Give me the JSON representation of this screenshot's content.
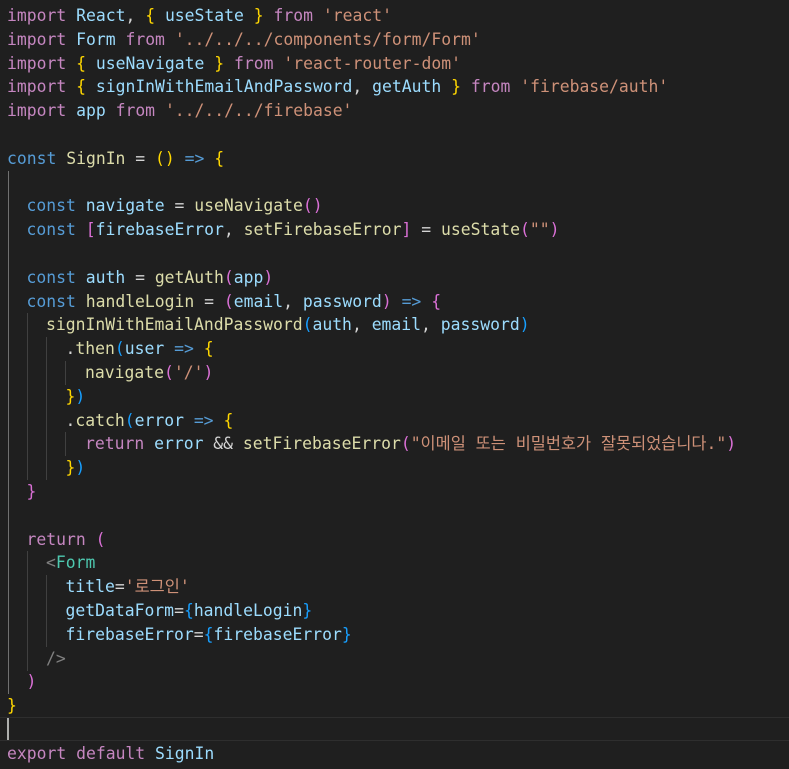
{
  "editor": {
    "colors": {
      "background": "#1f1f1f",
      "keyword_import": "#c586c0",
      "keyword": "#569cd6",
      "identifier": "#9cdcfe",
      "function": "#dcdcaa",
      "string": "#ce9178",
      "operator": "#d4d4d4",
      "bracket_gold": "#ffd700",
      "bracket_purple": "#da70d6",
      "bracket_blue": "#179fff",
      "tag": "#569cd6",
      "component": "#4ec9b0",
      "jsx_tag_bracket": "#808080"
    },
    "cursor_line": 30,
    "lines": [
      {
        "indent": 0,
        "tokens": [
          {
            "t": "import",
            "c": "keyword_import"
          },
          {
            "t": " "
          },
          {
            "t": "React",
            "c": "identifier"
          },
          {
            "t": ", "
          },
          {
            "t": "{",
            "c": "bracket_gold"
          },
          {
            "t": " "
          },
          {
            "t": "useState",
            "c": "identifier"
          },
          {
            "t": " "
          },
          {
            "t": "}",
            "c": "bracket_gold"
          },
          {
            "t": " "
          },
          {
            "t": "from",
            "c": "keyword_import"
          },
          {
            "t": " "
          },
          {
            "t": "'react'",
            "c": "string"
          }
        ]
      },
      {
        "indent": 0,
        "tokens": [
          {
            "t": "import",
            "c": "keyword_import"
          },
          {
            "t": " "
          },
          {
            "t": "Form",
            "c": "identifier"
          },
          {
            "t": " "
          },
          {
            "t": "from",
            "c": "keyword_import"
          },
          {
            "t": " "
          },
          {
            "t": "'../../../components/form/Form'",
            "c": "string"
          }
        ]
      },
      {
        "indent": 0,
        "tokens": [
          {
            "t": "import",
            "c": "keyword_import"
          },
          {
            "t": " "
          },
          {
            "t": "{",
            "c": "bracket_gold"
          },
          {
            "t": " "
          },
          {
            "t": "useNavigate",
            "c": "identifier"
          },
          {
            "t": " "
          },
          {
            "t": "}",
            "c": "bracket_gold"
          },
          {
            "t": " "
          },
          {
            "t": "from",
            "c": "keyword_import"
          },
          {
            "t": " "
          },
          {
            "t": "'react-router-dom'",
            "c": "string"
          }
        ]
      },
      {
        "indent": 0,
        "tokens": [
          {
            "t": "import",
            "c": "keyword_import"
          },
          {
            "t": " "
          },
          {
            "t": "{",
            "c": "bracket_gold"
          },
          {
            "t": " "
          },
          {
            "t": "signInWithEmailAndPassword",
            "c": "identifier"
          },
          {
            "t": ", "
          },
          {
            "t": "getAuth",
            "c": "identifier"
          },
          {
            "t": " "
          },
          {
            "t": "}",
            "c": "bracket_gold"
          },
          {
            "t": " "
          },
          {
            "t": "from",
            "c": "keyword_import"
          },
          {
            "t": " "
          },
          {
            "t": "'firebase/auth'",
            "c": "string"
          }
        ]
      },
      {
        "indent": 0,
        "tokens": [
          {
            "t": "import",
            "c": "keyword_import"
          },
          {
            "t": " "
          },
          {
            "t": "app",
            "c": "identifier"
          },
          {
            "t": " "
          },
          {
            "t": "from",
            "c": "keyword_import"
          },
          {
            "t": " "
          },
          {
            "t": "'../../../firebase'",
            "c": "string"
          }
        ]
      },
      {
        "indent": 0,
        "tokens": []
      },
      {
        "indent": 0,
        "tokens": [
          {
            "t": "const",
            "c": "keyword"
          },
          {
            "t": " "
          },
          {
            "t": "SignIn",
            "c": "function"
          },
          {
            "t": " = "
          },
          {
            "t": "(",
            "c": "bracket_gold"
          },
          {
            "t": ")",
            "c": "bracket_gold"
          },
          {
            "t": " "
          },
          {
            "t": "=>",
            "c": "keyword"
          },
          {
            "t": " "
          },
          {
            "t": "{",
            "c": "bracket_gold"
          }
        ]
      },
      {
        "indent": 0,
        "tokens": [],
        "guides": [
          1
        ]
      },
      {
        "indent": 1,
        "tokens": [
          {
            "t": "const",
            "c": "keyword"
          },
          {
            "t": " "
          },
          {
            "t": "navigate",
            "c": "identifier"
          },
          {
            "t": " = "
          },
          {
            "t": "useNavigate",
            "c": "function"
          },
          {
            "t": "(",
            "c": "bracket_purple"
          },
          {
            "t": ")",
            "c": "bracket_purple"
          }
        ],
        "guides": [
          1
        ]
      },
      {
        "indent": 1,
        "tokens": [
          {
            "t": "const",
            "c": "keyword"
          },
          {
            "t": " "
          },
          {
            "t": "[",
            "c": "bracket_purple"
          },
          {
            "t": "firebaseError",
            "c": "identifier"
          },
          {
            "t": ", "
          },
          {
            "t": "setFirebaseError",
            "c": "function"
          },
          {
            "t": "]",
            "c": "bracket_purple"
          },
          {
            "t": " = "
          },
          {
            "t": "useState",
            "c": "function"
          },
          {
            "t": "(",
            "c": "bracket_purple"
          },
          {
            "t": "\"\"",
            "c": "string"
          },
          {
            "t": ")",
            "c": "bracket_purple"
          }
        ],
        "guides": [
          1
        ]
      },
      {
        "indent": 0,
        "tokens": [],
        "guides": [
          1
        ]
      },
      {
        "indent": 1,
        "tokens": [
          {
            "t": "const",
            "c": "keyword"
          },
          {
            "t": " "
          },
          {
            "t": "auth",
            "c": "identifier"
          },
          {
            "t": " = "
          },
          {
            "t": "getAuth",
            "c": "function"
          },
          {
            "t": "(",
            "c": "bracket_purple"
          },
          {
            "t": "app",
            "c": "identifier"
          },
          {
            "t": ")",
            "c": "bracket_purple"
          }
        ],
        "guides": [
          1
        ]
      },
      {
        "indent": 1,
        "tokens": [
          {
            "t": "const",
            "c": "keyword"
          },
          {
            "t": " "
          },
          {
            "t": "handleLogin",
            "c": "function"
          },
          {
            "t": " = "
          },
          {
            "t": "(",
            "c": "bracket_purple"
          },
          {
            "t": "email",
            "c": "identifier"
          },
          {
            "t": ", "
          },
          {
            "t": "password",
            "c": "identifier"
          },
          {
            "t": ")",
            "c": "bracket_purple"
          },
          {
            "t": " "
          },
          {
            "t": "=>",
            "c": "keyword"
          },
          {
            "t": " "
          },
          {
            "t": "{",
            "c": "bracket_purple"
          }
        ],
        "guides": [
          1
        ]
      },
      {
        "indent": 2,
        "tokens": [
          {
            "t": "signInWithEmailAndPassword",
            "c": "function"
          },
          {
            "t": "(",
            "c": "bracket_blue"
          },
          {
            "t": "auth",
            "c": "identifier"
          },
          {
            "t": ", "
          },
          {
            "t": "email",
            "c": "identifier"
          },
          {
            "t": ", "
          },
          {
            "t": "password",
            "c": "identifier"
          },
          {
            "t": ")",
            "c": "bracket_blue"
          }
        ],
        "guides": [
          1,
          2
        ]
      },
      {
        "indent": 3,
        "tokens": [
          {
            "t": ".",
            "c": "operator"
          },
          {
            "t": "then",
            "c": "function"
          },
          {
            "t": "(",
            "c": "bracket_blue"
          },
          {
            "t": "user",
            "c": "identifier"
          },
          {
            "t": " "
          },
          {
            "t": "=>",
            "c": "keyword"
          },
          {
            "t": " "
          },
          {
            "t": "{",
            "c": "bracket_gold"
          }
        ],
        "guides": [
          1,
          2,
          3
        ]
      },
      {
        "indent": 4,
        "tokens": [
          {
            "t": "navigate",
            "c": "function"
          },
          {
            "t": "(",
            "c": "bracket_purple"
          },
          {
            "t": "'/'",
            "c": "string"
          },
          {
            "t": ")",
            "c": "bracket_purple"
          }
        ],
        "guides": [
          1,
          2,
          3,
          4
        ]
      },
      {
        "indent": 3,
        "tokens": [
          {
            "t": "}",
            "c": "bracket_gold"
          },
          {
            "t": ")",
            "c": "bracket_blue"
          }
        ],
        "guides": [
          1,
          2,
          3
        ]
      },
      {
        "indent": 3,
        "tokens": [
          {
            "t": ".",
            "c": "operator"
          },
          {
            "t": "catch",
            "c": "function"
          },
          {
            "t": "(",
            "c": "bracket_blue"
          },
          {
            "t": "error",
            "c": "identifier"
          },
          {
            "t": " "
          },
          {
            "t": "=>",
            "c": "keyword"
          },
          {
            "t": " "
          },
          {
            "t": "{",
            "c": "bracket_gold"
          }
        ],
        "guides": [
          1,
          2,
          3
        ]
      },
      {
        "indent": 4,
        "tokens": [
          {
            "t": "return",
            "c": "keyword_import"
          },
          {
            "t": " "
          },
          {
            "t": "error",
            "c": "identifier"
          },
          {
            "t": " && "
          },
          {
            "t": "setFirebaseError",
            "c": "function"
          },
          {
            "t": "(",
            "c": "bracket_purple"
          },
          {
            "t": "\"이메일 또는 비밀번호가 잘못되었습니다.\"",
            "c": "string"
          },
          {
            "t": ")",
            "c": "bracket_purple"
          }
        ],
        "guides": [
          1,
          2,
          3,
          4
        ]
      },
      {
        "indent": 3,
        "tokens": [
          {
            "t": "}",
            "c": "bracket_gold"
          },
          {
            "t": ")",
            "c": "bracket_blue"
          }
        ],
        "guides": [
          1,
          2,
          3
        ]
      },
      {
        "indent": 1,
        "tokens": [
          {
            "t": "}",
            "c": "bracket_purple"
          }
        ],
        "guides": [
          1
        ]
      },
      {
        "indent": 0,
        "tokens": [],
        "guides": [
          1
        ]
      },
      {
        "indent": 1,
        "tokens": [
          {
            "t": "return",
            "c": "keyword_import"
          },
          {
            "t": " "
          },
          {
            "t": "(",
            "c": "bracket_purple"
          }
        ],
        "guides": [
          1
        ]
      },
      {
        "indent": 2,
        "tokens": [
          {
            "t": "<",
            "c": "jsx_tag_bracket"
          },
          {
            "t": "Form",
            "c": "component"
          }
        ],
        "guides": [
          1,
          2
        ]
      },
      {
        "indent": 3,
        "tokens": [
          {
            "t": "title",
            "c": "identifier"
          },
          {
            "t": "="
          },
          {
            "t": "'로그인'",
            "c": "string"
          }
        ],
        "guides": [
          1,
          2,
          3
        ]
      },
      {
        "indent": 3,
        "tokens": [
          {
            "t": "getDataForm",
            "c": "identifier"
          },
          {
            "t": "="
          },
          {
            "t": "{",
            "c": "bracket_blue"
          },
          {
            "t": "handleLogin",
            "c": "identifier"
          },
          {
            "t": "}",
            "c": "bracket_blue"
          }
        ],
        "guides": [
          1,
          2,
          3
        ]
      },
      {
        "indent": 3,
        "tokens": [
          {
            "t": "firebaseError",
            "c": "identifier"
          },
          {
            "t": "="
          },
          {
            "t": "{",
            "c": "bracket_blue"
          },
          {
            "t": "firebaseError",
            "c": "identifier"
          },
          {
            "t": "}",
            "c": "bracket_blue"
          }
        ],
        "guides": [
          1,
          2,
          3
        ]
      },
      {
        "indent": 2,
        "tokens": [
          {
            "t": "/>",
            "c": "jsx_tag_bracket"
          }
        ],
        "guides": [
          1,
          2
        ]
      },
      {
        "indent": 1,
        "tokens": [
          {
            "t": ")",
            "c": "bracket_purple"
          }
        ],
        "guides": [
          1
        ]
      },
      {
        "indent": 0,
        "tokens": [
          {
            "t": "}",
            "c": "bracket_gold"
          }
        ]
      },
      {
        "indent": 0,
        "tokens": []
      },
      {
        "indent": 0,
        "tokens": [
          {
            "t": "export",
            "c": "keyword_import"
          },
          {
            "t": " "
          },
          {
            "t": "default",
            "c": "keyword_import"
          },
          {
            "t": " "
          },
          {
            "t": "SignIn",
            "c": "identifier"
          }
        ]
      }
    ]
  }
}
